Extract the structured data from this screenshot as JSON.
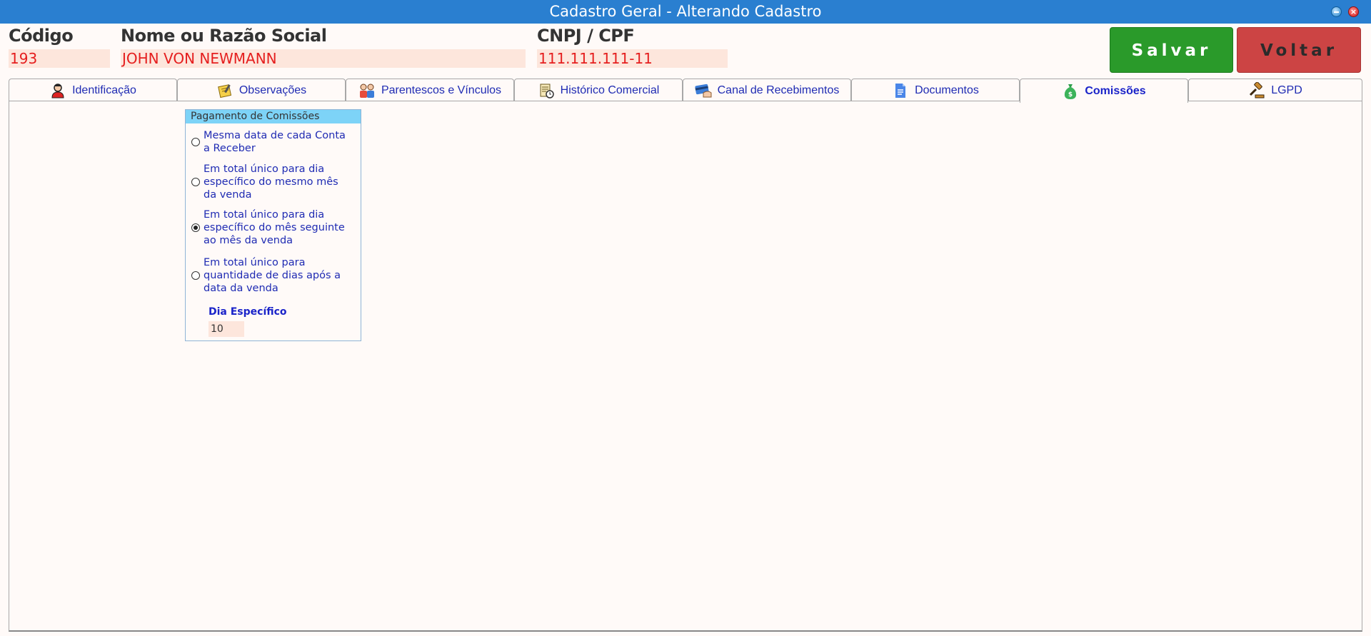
{
  "window": {
    "title": "Cadastro Geral - Alterando Cadastro"
  },
  "header": {
    "codigo": {
      "label": "Código",
      "value": "193"
    },
    "nome": {
      "label": "Nome ou Razão Social",
      "value": "JOHN VON NEWMANN"
    },
    "cnpj": {
      "label": "CNPJ / CPF",
      "value": "111.111.111-11"
    }
  },
  "actions": {
    "save_label": "Salvar",
    "back_label": "Voltar"
  },
  "tabs": [
    {
      "label": "Identificação",
      "icon": "person-icon"
    },
    {
      "label": "Observações",
      "icon": "notes-icon"
    },
    {
      "label": "Parentescos e Vínculos",
      "icon": "family-icon"
    },
    {
      "label": "Histórico Comercial",
      "icon": "history-icon"
    },
    {
      "label": "Canal de Recebimentos",
      "icon": "card-icon"
    },
    {
      "label": "Documentos",
      "icon": "document-icon"
    },
    {
      "label": "Comissões",
      "icon": "money-bag-icon",
      "active": true
    },
    {
      "label": "LGPD",
      "icon": "gavel-icon"
    }
  ],
  "commission_group": {
    "title": "Pagamento de Comissões",
    "options": [
      {
        "label": "Mesma data de cada Conta a Receber",
        "selected": false
      },
      {
        "label": "Em total único para dia específico do mesmo mês da venda",
        "selected": false
      },
      {
        "label": "Em total único para dia específico do mês seguinte ao mês da venda",
        "selected": true
      },
      {
        "label": "Em total único para quantidade de dias após a data da venda",
        "selected": false
      }
    ],
    "dia_especifico": {
      "label": "Dia Específico",
      "value": "10"
    }
  },
  "colors": {
    "titlebar": "#2a7fd0",
    "save": "#2a9a2a",
    "back": "#cc4444",
    "value_text": "#e51e1e",
    "field_bg": "#fde6dc",
    "group_header": "#7dd3f7"
  }
}
